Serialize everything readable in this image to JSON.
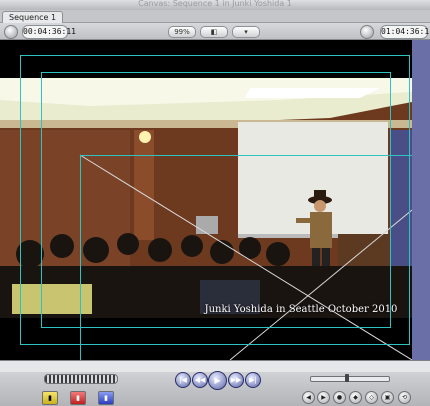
{
  "window": {
    "title": "Canvas: Sequence 1 in Junki Yoshida 1"
  },
  "tabs": [
    {
      "label": "Sequence 1"
    }
  ],
  "toolbar": {
    "duration": "00:04:36:11",
    "zoom": "99%",
    "current_timecode": "01:04:36:11",
    "view_icon": "overlay-view-icon",
    "zoom_menu_icon": "chevron-down-icon"
  },
  "video": {
    "caption": "Junki Yoshida in Seattle October 2010",
    "content": "presentation room with audience and speaker in cowboy hat"
  },
  "overlay": {
    "color": "#2ec3c0",
    "title_safe": true,
    "action_safe": true
  },
  "transport": {
    "buttons": [
      "go-to-in-icon",
      "previous-edit-icon",
      "play-icon",
      "next-edit-icon",
      "go-to-out-icon"
    ],
    "shuttle_position": 0.45
  },
  "edit_buttons": [
    "insert-icon",
    "overwrite-icon",
    "replace-icon"
  ],
  "mark_buttons": [
    "mark-in-icon",
    "mark-out-icon",
    "mark-clip-icon",
    "add-marker-icon",
    "add-keyframe-icon",
    "match-frame-icon",
    "playhead-sync-icon"
  ]
}
